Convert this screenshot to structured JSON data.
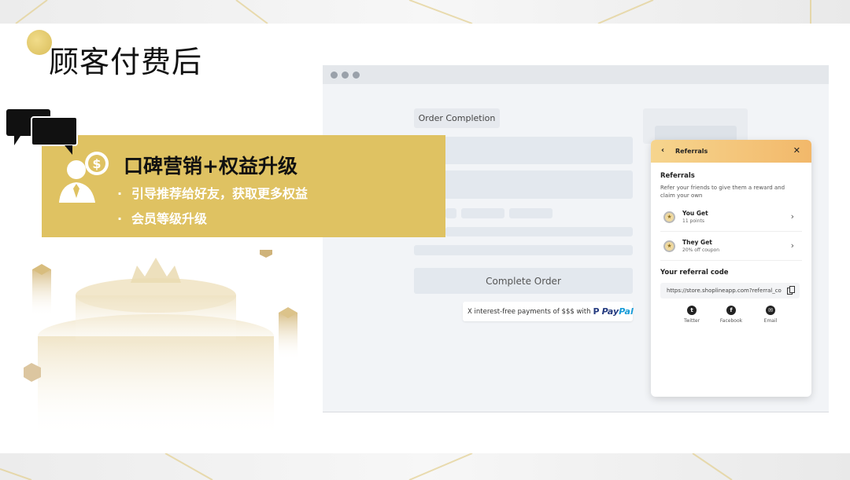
{
  "page": {
    "title": "顾客付费后"
  },
  "promo": {
    "title": "口碑营销+权益升级",
    "bullets": [
      "引导推荐给好友，获取更多权益",
      "会员等级升级"
    ],
    "bullet_char": "·"
  },
  "checkout": {
    "order_label": "Order Completion",
    "complete_button": "Complete Order",
    "payment_text": "X interest-free payments of $$$ with",
    "paypal_pay": "Pay",
    "paypal_pal": "Pal"
  },
  "referrals": {
    "header_title": "Referrals",
    "back_icon": "‹",
    "close_icon": "✕",
    "heading": "Referrals",
    "subtitle": "Refer your friends to give them a reward and claim your own",
    "items": [
      {
        "title": "You Get",
        "detail": "11 points"
      },
      {
        "title": "They Get",
        "detail": "20% off coupon"
      }
    ],
    "code_label": "Your referral code",
    "code_value": "https://store.shoplineapp.com?referral_co",
    "share": [
      {
        "label": "Twitter",
        "icon": "twitter-icon",
        "glyph": "t"
      },
      {
        "label": "Facebook",
        "icon": "facebook-icon",
        "glyph": "f"
      },
      {
        "label": "Email",
        "icon": "email-icon",
        "glyph": "✉"
      }
    ]
  },
  "colors": {
    "gold": "#dfc262",
    "panel_header_start": "#f6d58e",
    "panel_header_end": "#f2b86a",
    "paypal_dark": "#253b80",
    "paypal_light": "#179bd7"
  }
}
